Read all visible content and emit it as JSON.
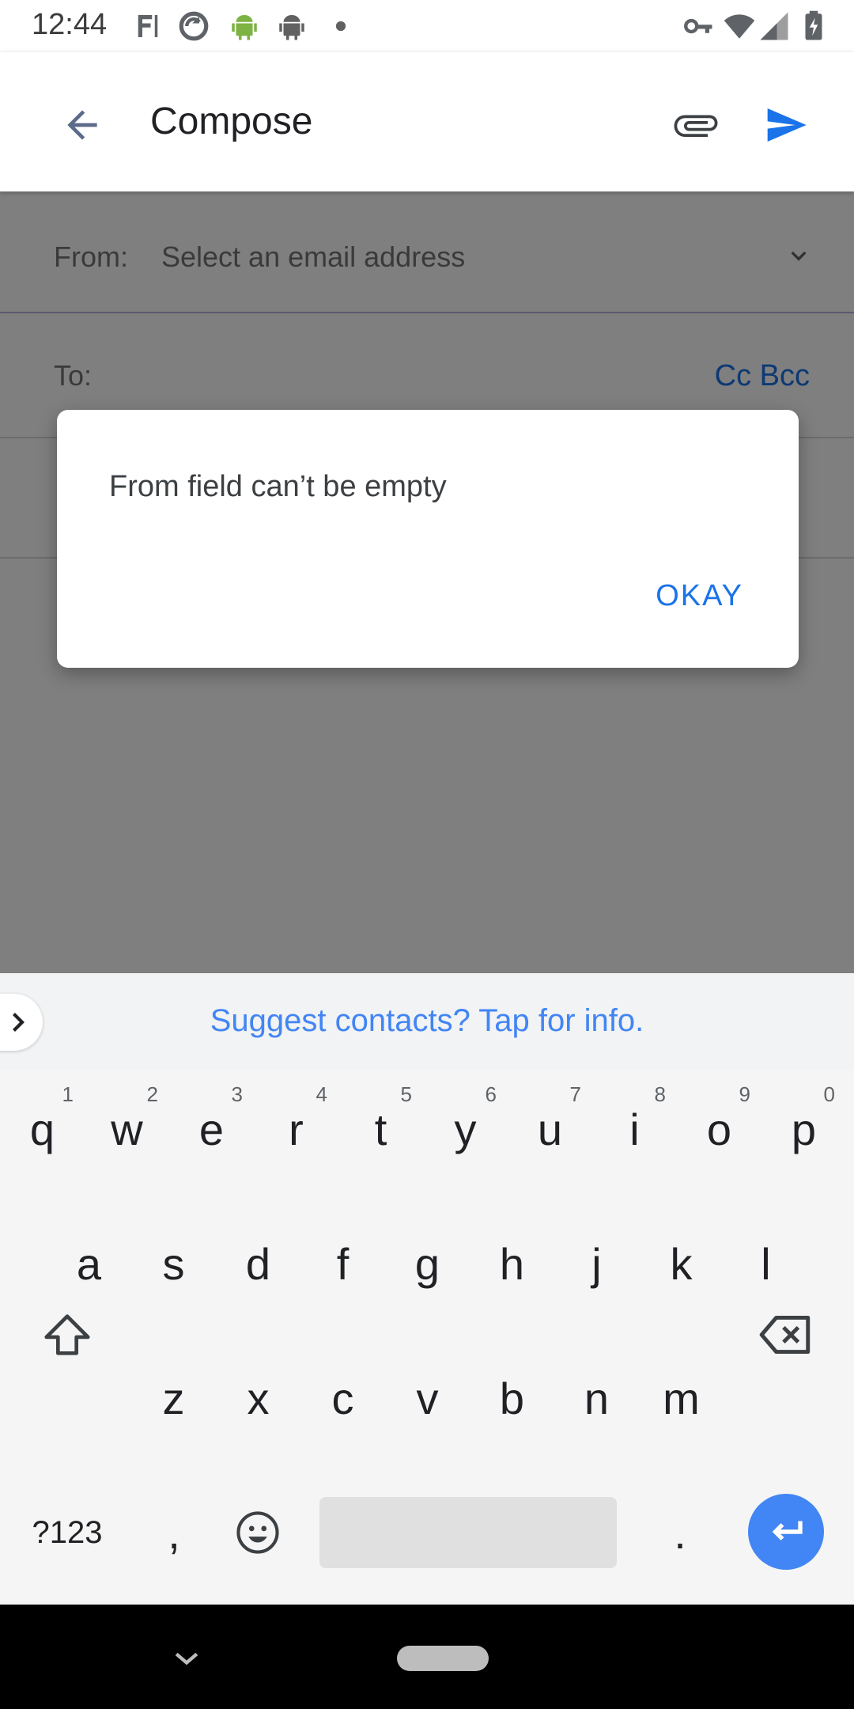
{
  "status_bar": {
    "time": "12:44",
    "left_icons": [
      "notification-icon",
      "sync-icon",
      "android-icon",
      "android-icon",
      "dot-icon"
    ],
    "right_icons": [
      "vpn-key-icon",
      "wifi-icon",
      "signal-icon",
      "battery-charging-icon"
    ]
  },
  "app_bar": {
    "title": "Compose",
    "back_icon": "arrow-back-icon",
    "attach_icon": "attach-icon",
    "send_icon": "send-icon"
  },
  "compose": {
    "from_label": "From:",
    "from_placeholder": "Select an email address",
    "to_label": "To:",
    "cc_bcc": "Cc Bcc"
  },
  "dialog": {
    "message": "From field can’t be empty",
    "okay": "OKAY"
  },
  "keyboard": {
    "suggestion": "Suggest contacts? Tap for info.",
    "row1": [
      {
        "k": "q",
        "h": "1"
      },
      {
        "k": "w",
        "h": "2"
      },
      {
        "k": "e",
        "h": "3"
      },
      {
        "k": "r",
        "h": "4"
      },
      {
        "k": "t",
        "h": "5"
      },
      {
        "k": "y",
        "h": "6"
      },
      {
        "k": "u",
        "h": "7"
      },
      {
        "k": "i",
        "h": "8"
      },
      {
        "k": "o",
        "h": "9"
      },
      {
        "k": "p",
        "h": "0"
      }
    ],
    "row2": [
      "a",
      "s",
      "d",
      "f",
      "g",
      "h",
      "j",
      "k",
      "l"
    ],
    "row3": [
      "z",
      "x",
      "c",
      "v",
      "b",
      "n",
      "m"
    ],
    "symbols_key": "?123",
    "comma_key": ",",
    "period_key": "."
  },
  "colors": {
    "accent": "#1a73e8",
    "suggest_text": "#4285f4",
    "enter_key": "#4285f4"
  }
}
